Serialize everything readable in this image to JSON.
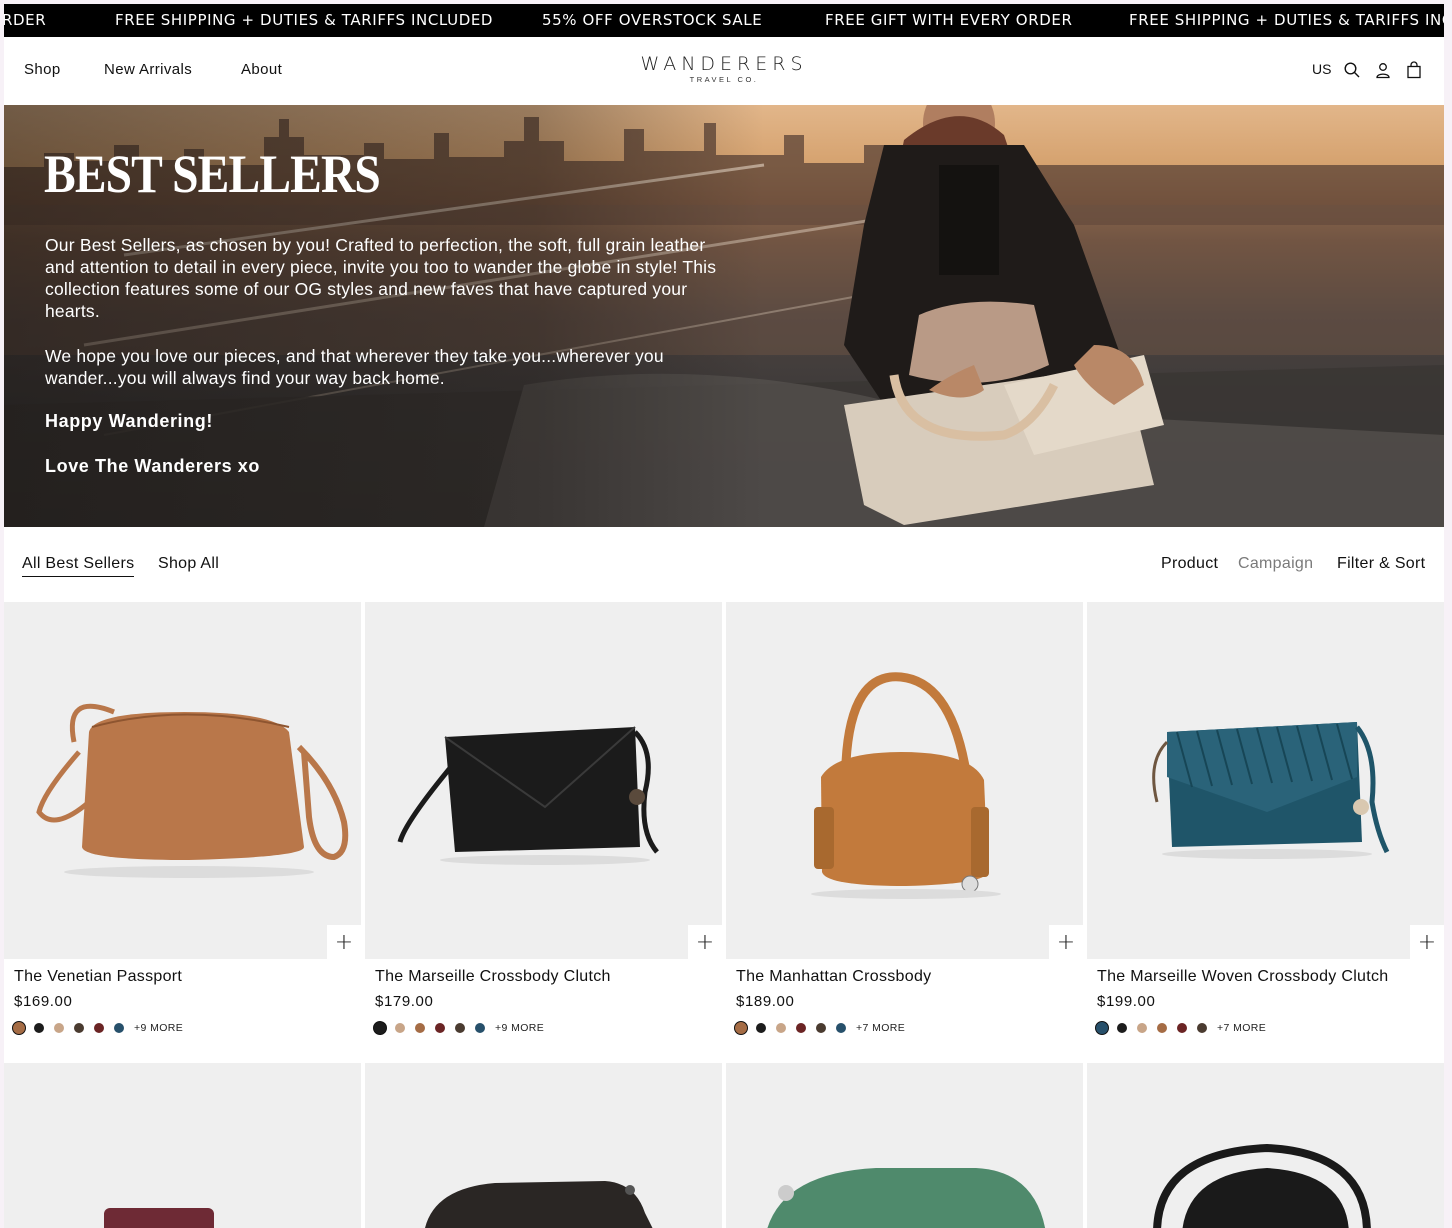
{
  "announcement": {
    "items": [
      "RDER",
      "FREE SHIPPING + DUTIES & TARIFFS INCLUDED",
      "55% OFF OVERSTOCK SALE",
      "FREE GIFT WITH EVERY ORDER",
      "FREE SHIPPING + DUTIES & TARIFFS INCLU"
    ]
  },
  "header": {
    "nav": [
      "Shop",
      "New Arrivals",
      "About"
    ],
    "logo_main": "WANDERERS",
    "logo_sub": "TRAVEL CO.",
    "region": "US",
    "icons": [
      "search-icon",
      "account-icon",
      "cart-icon"
    ]
  },
  "hero": {
    "title": "BEST SELLERS",
    "paragraph1": "Our Best Sellers, as chosen by you! Crafted to perfection, the soft, full grain leather and attention to detail in every piece, invite you too to wander the globe in style! This collection features some of our OG styles and new faves that have captured your hearts.",
    "paragraph2": "We hope you love our pieces, and that wherever they take you...wherever you wander...you will always find your way back home.",
    "signoff1": "Happy Wandering!",
    "signoff2": "Love The Wanderers xo"
  },
  "subnav": {
    "left": [
      "All Best Sellers",
      "Shop All"
    ],
    "right": [
      "Product",
      "Campaign",
      "Filter & Sort"
    ],
    "active": "All Best Sellers"
  },
  "products": [
    {
      "name": "The Venetian Passport",
      "price": "$169.00",
      "more": "+9 MORE",
      "bag_color": "#b9774a",
      "swatches": [
        "#a56c45",
        "#1c1c1c",
        "#c8a588",
        "#4a3b30",
        "#6b2424",
        "#27506b"
      ]
    },
    {
      "name": "The Marseille Crossbody Clutch",
      "price": "$179.00",
      "more": "+9 MORE",
      "bag_color": "#1b1b1b",
      "swatches": [
        "#1c1c1c",
        "#c8a588",
        "#a56c45",
        "#6b2424",
        "#4a3b30",
        "#27506b"
      ]
    },
    {
      "name": "The Manhattan Crossbody",
      "price": "$189.00",
      "more": "+7 MORE",
      "bag_color": "#c27a3c",
      "swatches": [
        "#a56c45",
        "#1c1c1c",
        "#c8a588",
        "#6b2424",
        "#4a3b30",
        "#27506b"
      ]
    },
    {
      "name": "The Marseille Woven Crossbody Clutch",
      "price": "$199.00",
      "more": "+7 MORE",
      "bag_color": "#1f5569",
      "swatches": [
        "#27506b",
        "#1c1c1c",
        "#c8a588",
        "#a56c45",
        "#6b2424",
        "#4a3b30"
      ]
    }
  ],
  "products_row2": [
    {
      "bag_color": "#6e2a35"
    },
    {
      "bag_color": "#2a2624"
    },
    {
      "bag_color": "#4f8a6c"
    },
    {
      "bag_color": "#1a1a1a"
    }
  ],
  "colors": {
    "accent": "#000000",
    "muted": "#777777"
  }
}
